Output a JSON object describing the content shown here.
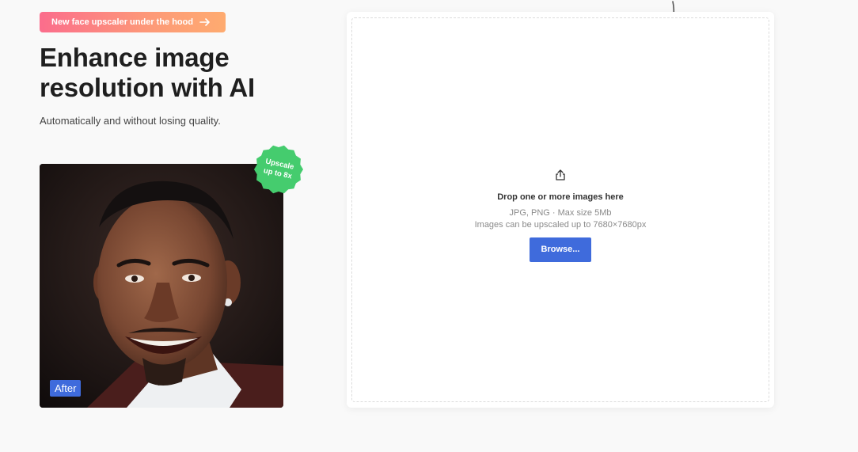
{
  "promo": {
    "label": "New face upscaler under the hood",
    "arrow_icon": "arrow-right-icon"
  },
  "hero": {
    "title": "Enhance image resolution with AI",
    "subtitle": "Automatically and without losing quality."
  },
  "sample": {
    "badge_line1": "Upscale",
    "badge_line2": "up to 8x",
    "after_label": "After"
  },
  "upload": {
    "icon": "upload-icon",
    "title": "Drop one or more images here",
    "formats": "JPG, PNG · Max size 5Mb",
    "limit": "Images can be upscaled up to 7680×7680px",
    "browse_label": "Browse..."
  },
  "colors": {
    "accent": "#3f6bdc",
    "badge_green": "#45cc6e",
    "promo_gradient_start": "#fb6d8c",
    "promo_gradient_end": "#feab70"
  }
}
